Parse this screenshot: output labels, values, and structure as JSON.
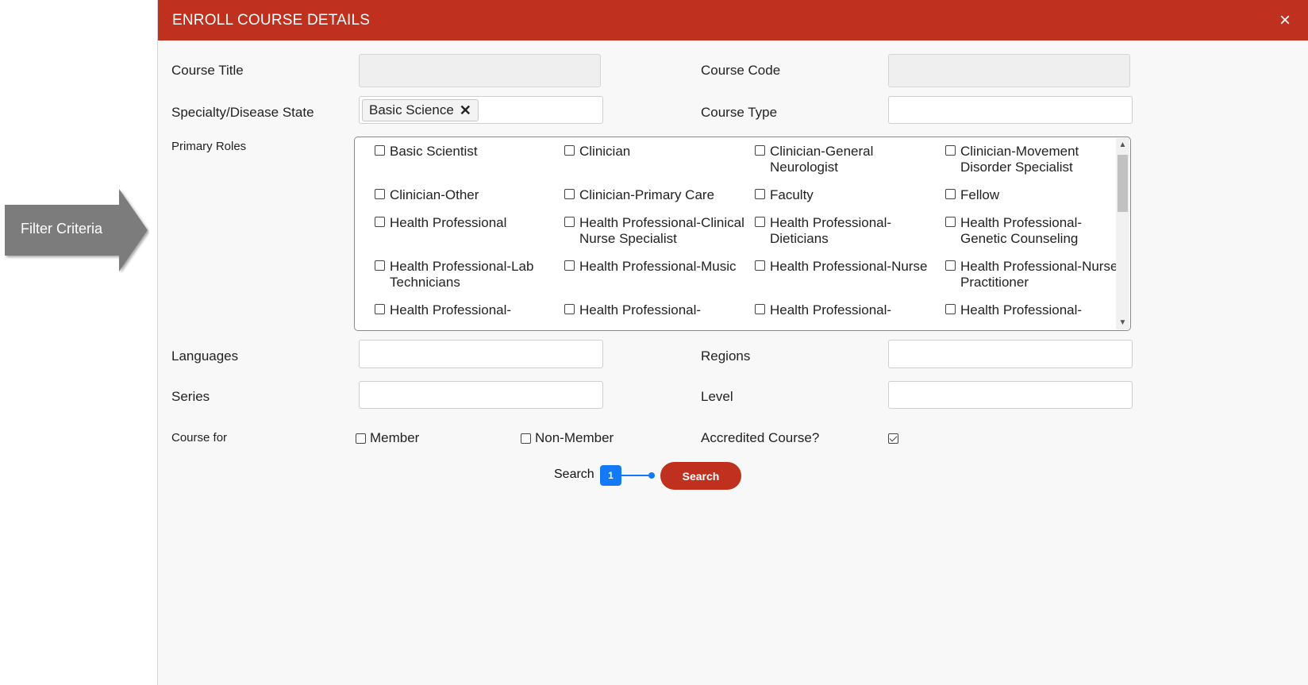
{
  "callout": {
    "label": "Filter Criteria"
  },
  "modal": {
    "title": "ENROLL COURSE DETAILS",
    "close_glyph": "×"
  },
  "form": {
    "course_title_label": "Course Title",
    "course_title_value": "",
    "course_code_label": "Course Code",
    "course_code_value": "",
    "specialty_label": "Specialty/Disease State",
    "specialty_selected": "Basic Science",
    "course_type_label": "Course Type",
    "course_type_value": "",
    "primary_roles_label": "Primary Roles",
    "roles": [
      {
        "label": "Basic Scientist",
        "checked": false
      },
      {
        "label": "Clinician",
        "checked": false
      },
      {
        "label": "Clinician-General Neurologist",
        "checked": false
      },
      {
        "label": "Clinician-Movement Disorder Specialist",
        "checked": false
      },
      {
        "label": "Clinician-Other",
        "checked": false
      },
      {
        "label": "Clinician-Primary Care",
        "checked": false
      },
      {
        "label": "Faculty",
        "checked": false
      },
      {
        "label": "Fellow",
        "checked": false
      },
      {
        "label": "Health Professional",
        "checked": false
      },
      {
        "label": "Health Professional-Clinical Nurse Specialist",
        "checked": false
      },
      {
        "label": "Health Professional-Dieticians",
        "checked": false
      },
      {
        "label": "Health Professional-Genetic Counseling",
        "checked": false
      },
      {
        "label": "Health Professional-Lab Technicians",
        "checked": false
      },
      {
        "label": "Health Professional-Music",
        "checked": false
      },
      {
        "label": "Health Professional-Nurse",
        "checked": false
      },
      {
        "label": "Health Professional-Nurse Practitioner",
        "checked": false
      },
      {
        "label": "Health Professional-",
        "checked": false
      },
      {
        "label": "Health Professional-",
        "checked": false
      },
      {
        "label": "Health Professional-",
        "checked": false
      },
      {
        "label": "Health Professional-",
        "checked": false
      }
    ],
    "languages_label": "Languages",
    "languages_value": "",
    "regions_label": "Regions",
    "regions_value": "",
    "series_label": "Series",
    "series_value": "",
    "level_label": "Level",
    "level_value": "",
    "course_for_label": "Course for",
    "member_label": "Member",
    "member_checked": false,
    "non_member_label": "Non-Member",
    "non_member_checked": false,
    "accredited_label": "Accredited Course?",
    "accredited_checked": true
  },
  "search": {
    "caption": "Search",
    "badge": "1",
    "button_label": "Search"
  },
  "colors": {
    "header": "#c0301f",
    "badge": "#1479f7",
    "callout": "#7b7b7b"
  }
}
